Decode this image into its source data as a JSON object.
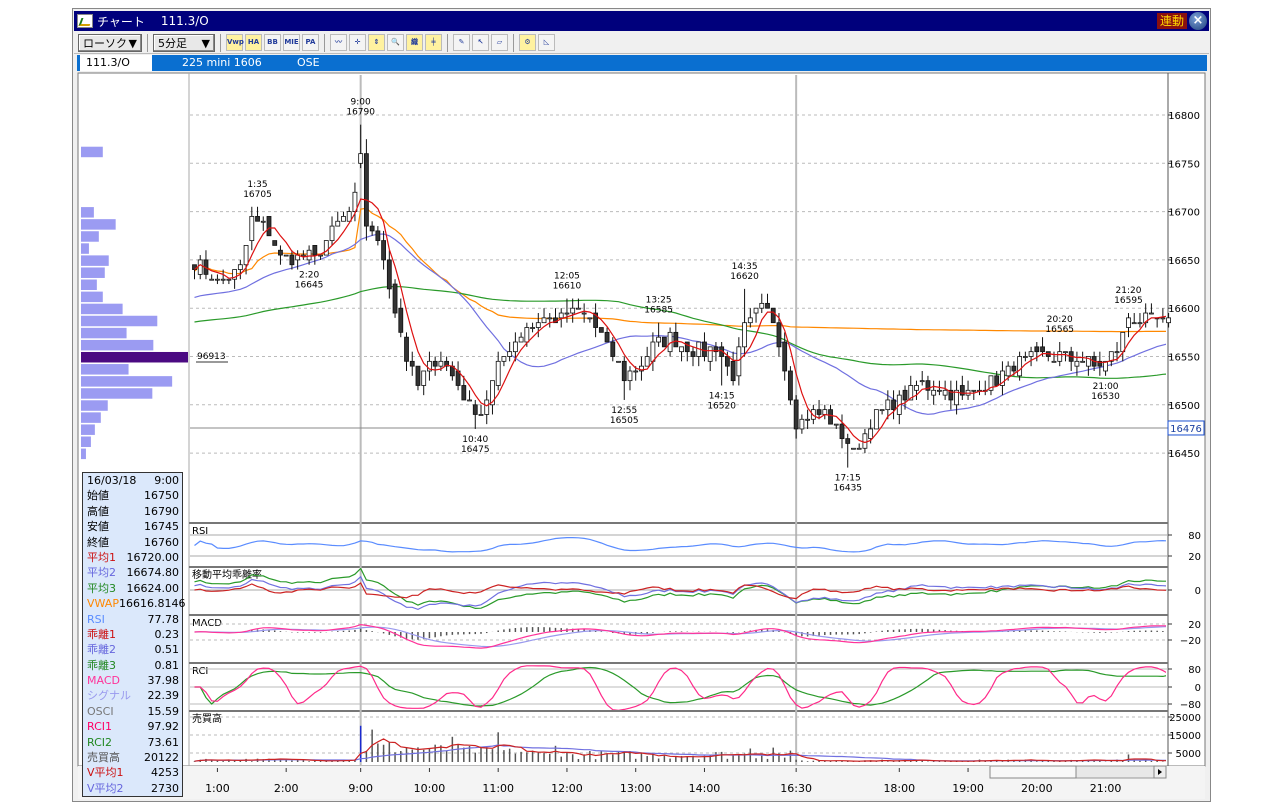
{
  "window": {
    "title": "チャート",
    "code": "111.3/O",
    "link_label": "連動",
    "close_label": "×"
  },
  "toolbar": {
    "chart_type": "ローソク",
    "interval": "5分足",
    "icons": [
      {
        "name": "vwap-icon",
        "text": "Vwp"
      },
      {
        "name": "ha-icon",
        "text": "HA"
      },
      {
        "name": "bb-icon",
        "text": "BB"
      },
      {
        "name": "mie-icon",
        "text": "MIE"
      },
      {
        "name": "pa-icon",
        "text": "PA"
      },
      {
        "name": "line-chart-icon",
        "text": "〰"
      },
      {
        "name": "crosshair-icon",
        "text": "✛"
      },
      {
        "name": "scale-icon",
        "text": "⇕"
      },
      {
        "name": "magnifier-icon",
        "text": "🔍"
      },
      {
        "name": "kanji-tool-icon",
        "text": "織"
      },
      {
        "name": "bar-settings-icon",
        "text": "╪"
      },
      {
        "name": "pencil-icon",
        "text": "✎"
      },
      {
        "name": "pointer-icon",
        "text": "↖"
      },
      {
        "name": "eraser-icon",
        "text": "▱"
      },
      {
        "name": "gear-icon",
        "text": "⚙"
      },
      {
        "name": "triangle-ruler-icon",
        "text": "◺"
      }
    ]
  },
  "info_bar": {
    "code": "111.3/O",
    "name": "225 mini 1606",
    "exchange": "OSE"
  },
  "data_box": {
    "date": "16/03/18",
    "time": "9:00",
    "rows": [
      {
        "label": "始値",
        "value": "16750",
        "color": "#000000"
      },
      {
        "label": "高値",
        "value": "16790",
        "color": "#000000"
      },
      {
        "label": "安値",
        "value": "16745",
        "color": "#000000"
      },
      {
        "label": "終値",
        "value": "16760",
        "color": "#000000"
      },
      {
        "label": "平均1",
        "value": "16720.00",
        "color": "#cc1111"
      },
      {
        "label": "平均2",
        "value": "16674.80",
        "color": "#6666dd"
      },
      {
        "label": "平均3",
        "value": "16624.00",
        "color": "#228822"
      },
      {
        "label": "VWAP",
        "value": "16616.8146",
        "color": "#ff8800"
      },
      {
        "label": "RSI",
        "value": "77.78",
        "color": "#5a8cff"
      },
      {
        "label": "乖離1",
        "value": "0.23",
        "color": "#cc1111"
      },
      {
        "label": "乖離2",
        "value": "0.51",
        "color": "#6666dd"
      },
      {
        "label": "乖離3",
        "value": "0.81",
        "color": "#228822"
      },
      {
        "label": "MACD",
        "value": "37.98",
        "color": "#ff3399"
      },
      {
        "label": "シグナル",
        "value": "22.39",
        "color": "#9999ee"
      },
      {
        "label": "OSCI",
        "value": "15.59",
        "color": "#777777"
      },
      {
        "label": "RCI1",
        "value": "97.92",
        "color": "#ff0066"
      },
      {
        "label": "RCI2",
        "value": "73.61",
        "color": "#228822"
      },
      {
        "label": "売買高",
        "value": "20122",
        "color": "#555555"
      },
      {
        "label": "V平均1",
        "value": "4253",
        "color": "#cc1111"
      },
      {
        "label": "V平均2",
        "value": "2730",
        "color": "#6666dd"
      }
    ]
  },
  "chart_data": {
    "type": "candlestick",
    "bars": 171,
    "seed": 7,
    "price_ticks": [
      16800,
      16750,
      16700,
      16650,
      16600,
      16550,
      16500,
      16450
    ],
    "current_price": 16476,
    "close_anchors": [
      [
        0,
        16645
      ],
      [
        2,
        16640
      ],
      [
        4,
        16625
      ],
      [
        8,
        16640
      ],
      [
        10,
        16690
      ],
      [
        13,
        16680
      ],
      [
        15,
        16650
      ],
      [
        19,
        16655
      ],
      [
        21,
        16650
      ],
      [
        24,
        16680
      ],
      [
        27,
        16700
      ],
      [
        28,
        16715
      ],
      [
        29,
        16760
      ],
      [
        30,
        16685
      ],
      [
        31,
        16680
      ],
      [
        33,
        16650
      ],
      [
        35,
        16600
      ],
      [
        37,
        16550
      ],
      [
        39,
        16520
      ],
      [
        41,
        16540
      ],
      [
        43,
        16550
      ],
      [
        46,
        16520
      ],
      [
        48,
        16500
      ],
      [
        50,
        16490
      ],
      [
        53,
        16540
      ],
      [
        55,
        16560
      ],
      [
        58,
        16580
      ],
      [
        61,
        16590
      ],
      [
        64,
        16590
      ],
      [
        67,
        16600
      ],
      [
        69,
        16590
      ],
      [
        72,
        16560
      ],
      [
        75,
        16530
      ],
      [
        77,
        16535
      ],
      [
        80,
        16560
      ],
      [
        83,
        16570
      ],
      [
        85,
        16560
      ],
      [
        89,
        16555
      ],
      [
        91,
        16560
      ],
      [
        94,
        16530
      ],
      [
        96,
        16580
      ],
      [
        99,
        16600
      ],
      [
        101,
        16590
      ],
      [
        103,
        16540
      ],
      [
        105,
        16480
      ],
      [
        108,
        16490
      ],
      [
        110,
        16490
      ],
      [
        113,
        16470
      ],
      [
        115,
        16450
      ],
      [
        117,
        16470
      ],
      [
        119,
        16490
      ],
      [
        122,
        16500
      ],
      [
        124,
        16510
      ],
      [
        127,
        16520
      ],
      [
        130,
        16520
      ],
      [
        134,
        16505
      ],
      [
        137,
        16520
      ],
      [
        141,
        16530
      ],
      [
        144,
        16545
      ],
      [
        148,
        16550
      ],
      [
        152,
        16550
      ],
      [
        155,
        16545
      ],
      [
        158,
        16540
      ],
      [
        161,
        16555
      ],
      [
        163,
        16590
      ],
      [
        167,
        16590
      ],
      [
        170,
        16585
      ]
    ],
    "highlight_bar": {
      "index": 29,
      "open": 16750,
      "high": 16790,
      "low": 16745,
      "close": 16760,
      "volume": 20122
    },
    "annotations": [
      {
        "time": "1:35",
        "price": "16705",
        "bar": 11,
        "pos": "above"
      },
      {
        "time": "2:20",
        "price": "16645",
        "bar": 20,
        "pos": "below"
      },
      {
        "time": "9:00",
        "price": "16790",
        "bar": 29,
        "pos": "above"
      },
      {
        "time": "10:40",
        "price": "16475",
        "bar": 49,
        "pos": "below"
      },
      {
        "time": "12:05",
        "price": "16610",
        "bar": 65,
        "pos": "above"
      },
      {
        "time": "12:55",
        "price": "16505",
        "bar": 75,
        "pos": "below"
      },
      {
        "time": "13:25",
        "price": "16585",
        "bar": 81,
        "pos": "above"
      },
      {
        "time": "14:15",
        "price": "16520",
        "bar": 92,
        "pos": "below"
      },
      {
        "time": "14:35",
        "price": "16620",
        "bar": 96,
        "pos": "above"
      },
      {
        "time": "17:15",
        "price": "16435",
        "bar": 114,
        "pos": "below"
      },
      {
        "time": "20:20",
        "price": "16565",
        "bar": 151,
        "pos": "above"
      },
      {
        "time": "21:00",
        "price": "16530",
        "bar": 159,
        "pos": "below"
      },
      {
        "time": "21:20",
        "price": "16595",
        "bar": 163,
        "pos": "above"
      }
    ],
    "x_ticks": [
      {
        "label": "1:00",
        "bar": 4
      },
      {
        "label": "2:00",
        "bar": 16
      },
      {
        "label": "9:00",
        "bar": 29
      },
      {
        "label": "10:00",
        "bar": 41
      },
      {
        "label": "11:00",
        "bar": 53
      },
      {
        "label": "12:00",
        "bar": 65
      },
      {
        "label": "13:00",
        "bar": 77
      },
      {
        "label": "14:00",
        "bar": 89
      },
      {
        "label": "16:30",
        "bar": 105
      },
      {
        "label": "18:00",
        "bar": 123
      },
      {
        "label": "19:00",
        "bar": 135
      },
      {
        "label": "20:00",
        "bar": 147
      },
      {
        "label": "21:00",
        "bar": 159
      }
    ],
    "session_lines": [
      29,
      105
    ],
    "volume_profile": {
      "top_price": 16762,
      "step": 12.5,
      "values": [
        22,
        0,
        0,
        0,
        0,
        13,
        35,
        18,
        8,
        28,
        24,
        16,
        22,
        42,
        77,
        46,
        73,
        108,
        48,
        92,
        72,
        27,
        20,
        14,
        10,
        5
      ],
      "highlight_index": 17,
      "highlight_label": "96913"
    },
    "moving_averages": [
      {
        "name": "平均1",
        "period": 5,
        "color": "#dd1111"
      },
      {
        "name": "平均2",
        "period": 25,
        "color": "#7070e0"
      },
      {
        "name": "平均3",
        "period": 75,
        "color": "#2a9a2a"
      },
      {
        "name": "VWAP",
        "color": "#ff8800"
      }
    ],
    "panels": [
      {
        "id": "rsi",
        "label": "RSI",
        "ticks": [
          "80",
          "20"
        ]
      },
      {
        "id": "dev",
        "label": "移動平均乖離率",
        "ticks": [
          "0"
        ]
      },
      {
        "id": "macd",
        "label": "MACD",
        "ticks": [
          "20",
          "−20"
        ]
      },
      {
        "id": "rci",
        "label": "RCI",
        "ticks": [
          "80",
          "0",
          "−80"
        ]
      },
      {
        "id": "vol",
        "label": "売買高",
        "ticks": [
          "25000",
          "15000",
          "5000"
        ]
      }
    ],
    "volume_spikes": [
      [
        29,
        20122
      ],
      [
        31,
        18000
      ],
      [
        45,
        14000
      ],
      [
        53,
        16500
      ],
      [
        63,
        9000
      ],
      [
        97,
        7500
      ],
      [
        101,
        8000
      ],
      [
        163,
        4200
      ]
    ]
  }
}
